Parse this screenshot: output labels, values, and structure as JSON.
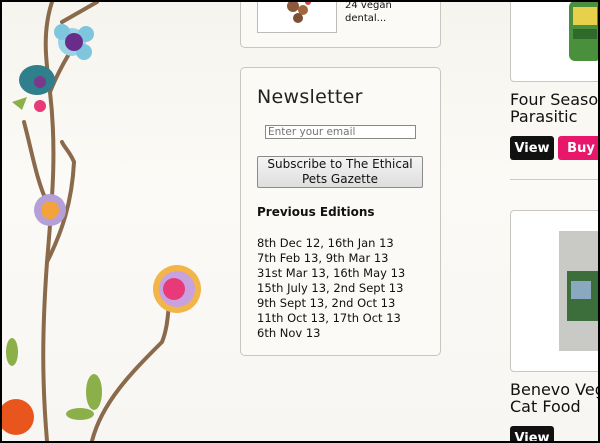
{
  "top_product": {
    "text": "24 vegan dental..."
  },
  "newsletter": {
    "title": "Newsletter",
    "email_placeholder": "Enter your email",
    "subscribe_label": "Subscribe to The Ethical Pets Gazette",
    "previous_heading": "Previous Editions",
    "editions": [
      "8th Dec 12, 16th Jan 13",
      "7th Feb 13, 9th Mar 13",
      "31st Mar 13, 16th May 13",
      "15th July 13, 2nd Sept 13",
      "9th Sept 13, 2nd Oct 13",
      "11th Oct 13, 17th Oct 13",
      "6th Nov 13"
    ]
  },
  "products": [
    {
      "name_line1": "Four Seaso",
      "name_line2": "Parasitic",
      "view_label": "View",
      "buy_label": "Buy"
    },
    {
      "name_line1": "Benevo Veg",
      "name_line2": "Cat Food",
      "view_label": "View"
    }
  ],
  "colors": {
    "buy": "#e8176c",
    "view": "#111111"
  }
}
